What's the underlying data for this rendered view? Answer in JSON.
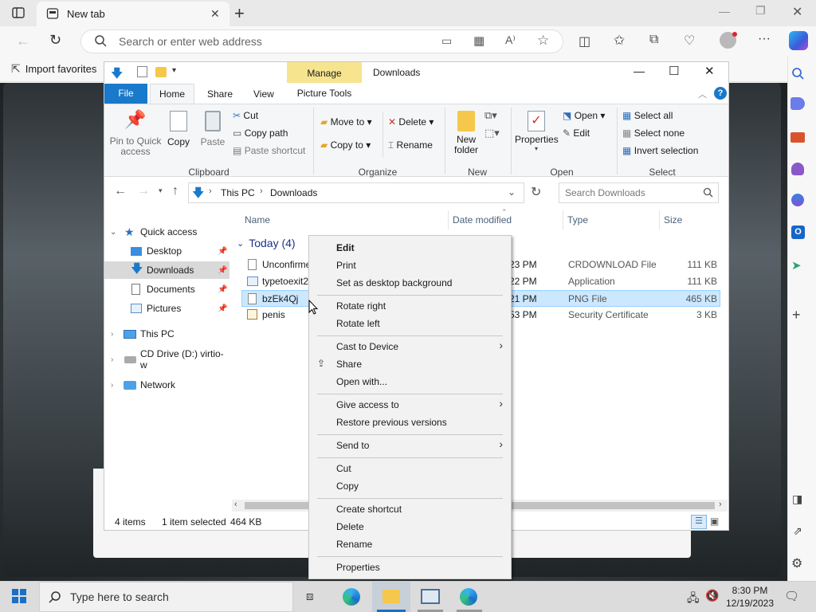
{
  "browser": {
    "tab_title": "New tab",
    "address_placeholder": "Search or enter web address",
    "favorites_label": "Import favorites"
  },
  "explorer": {
    "window_title": "Downloads",
    "manage_tab": "Manage",
    "picture_tools_tab": "Picture Tools",
    "ribbon_tabs": [
      "File",
      "Home",
      "Share",
      "View"
    ],
    "clipboard": {
      "pin_label": "Pin to Quick access",
      "copy_label": "Copy",
      "paste_label": "Paste",
      "cut_label": "Cut",
      "copy_path_label": "Copy path",
      "paste_shortcut_label": "Paste shortcut",
      "group_label": "Clipboard"
    },
    "organize": {
      "move_to_label": "Move to",
      "copy_to_label": "Copy to",
      "delete_label": "Delete",
      "rename_label": "Rename",
      "group_label": "Organize"
    },
    "new_group": {
      "new_folder_label": "New folder",
      "group_label": "New"
    },
    "open_group": {
      "properties_label": "Properties",
      "open_label": "Open",
      "edit_label": "Edit",
      "group_label": "Open"
    },
    "select_group": {
      "select_all_label": "Select all",
      "select_none_label": "Select none",
      "invert_label": "Invert selection",
      "group_label": "Select"
    },
    "path": [
      "This PC",
      "Downloads"
    ],
    "search_placeholder": "Search Downloads",
    "nav": [
      {
        "label": "Quick access"
      },
      {
        "label": "Desktop"
      },
      {
        "label": "Downloads"
      },
      {
        "label": "Documents"
      },
      {
        "label": "Pictures"
      },
      {
        "label": "This PC"
      },
      {
        "label": "CD Drive (D:) virtio-w"
      },
      {
        "label": "Network"
      }
    ],
    "columns": [
      "Name",
      "Date modified",
      "Type",
      "Size"
    ],
    "group_header": "Today (4)",
    "files": [
      {
        "name": "Unconfirme",
        "date": "23 PM",
        "type": "CRDOWNLOAD File",
        "size": "111 KB"
      },
      {
        "name": "typetoexit2",
        "date": "22 PM",
        "type": "Application",
        "size": "111 KB"
      },
      {
        "name": "bzEk4Qj",
        "date": "21 PM",
        "type": "PNG File",
        "size": "465 KB"
      },
      {
        "name": "penis",
        "date": "53 PM",
        "type": "Security Certificate",
        "size": "3 KB"
      }
    ],
    "status_items": "4 items",
    "status_selected": "1 item selected",
    "status_size": "464 KB"
  },
  "context_menu": {
    "edit": "Edit",
    "print": "Print",
    "set_bg": "Set as desktop background",
    "rotate_right": "Rotate right",
    "rotate_left": "Rotate left",
    "cast": "Cast to Device",
    "share": "Share",
    "open_with": "Open with...",
    "give_access": "Give access to",
    "restore": "Restore previous versions",
    "send_to": "Send to",
    "cut": "Cut",
    "copy": "Copy",
    "create_shortcut": "Create shortcut",
    "delete": "Delete",
    "rename": "Rename",
    "properties": "Properties"
  },
  "taskbar": {
    "search_placeholder": "Type here to search",
    "time": "8:30 PM",
    "date": "12/19/2023"
  },
  "colors": {
    "accent": "#1979ca",
    "selection": "#cce8ff",
    "manage_tab": "#f7e48f"
  }
}
